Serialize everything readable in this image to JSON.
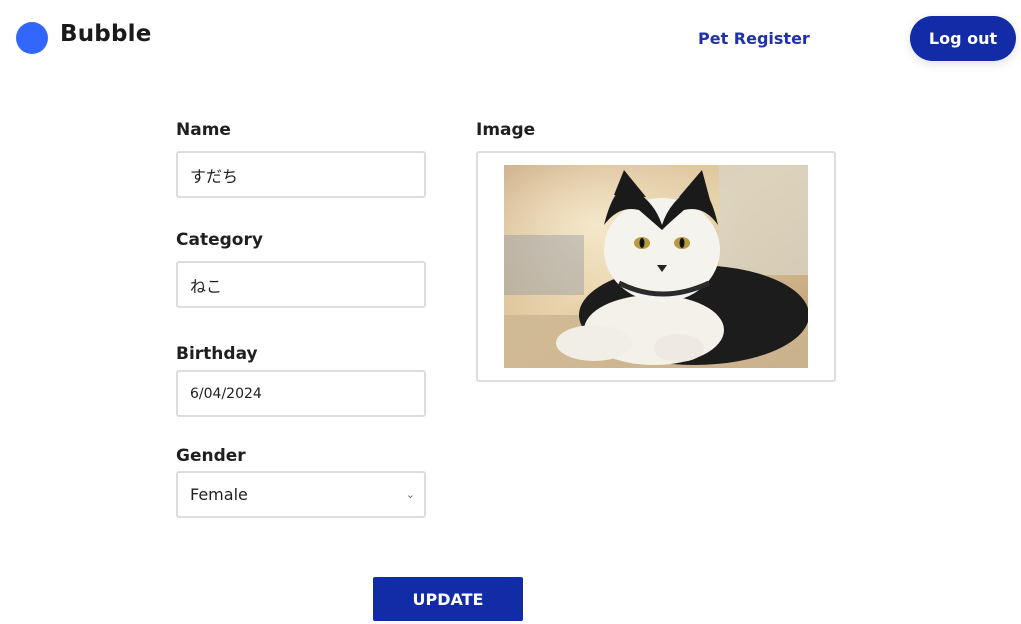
{
  "header": {
    "brand": "Bubble",
    "nav_link": "Pet Register",
    "logout_label": "Log out",
    "accent_color": "#3366ff",
    "button_color": "#122ba6"
  },
  "form": {
    "name_label": "Name",
    "name_value": "すだち",
    "category_label": "Category",
    "category_value": "ねこ",
    "birthday_label": "Birthday",
    "birthday_value": "6/04/2024",
    "gender_label": "Gender",
    "gender_value": "Female",
    "image_label": "Image",
    "update_label": "UPDATE"
  }
}
